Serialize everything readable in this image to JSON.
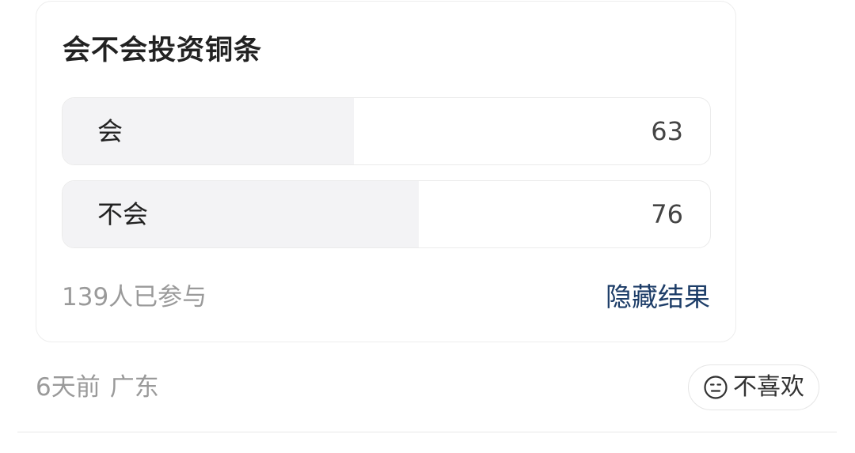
{
  "poll": {
    "title": "会不会投资铜条",
    "options": [
      {
        "label": "会",
        "count": "63",
        "fill_fraction": 0.45
      },
      {
        "label": "不会",
        "count": "76",
        "fill_fraction": 0.55
      }
    ],
    "participants": "139人已参与",
    "hide_results_label": "隐藏结果"
  },
  "meta": {
    "time": "6天前",
    "location": "广东"
  },
  "dislike": {
    "label": "不喜欢",
    "icon": "neutral-face-icon"
  },
  "colors": {
    "bar_fill": "#f3f3f5",
    "link": "#1d3d68",
    "secondary_text": "#9a9a9a"
  }
}
